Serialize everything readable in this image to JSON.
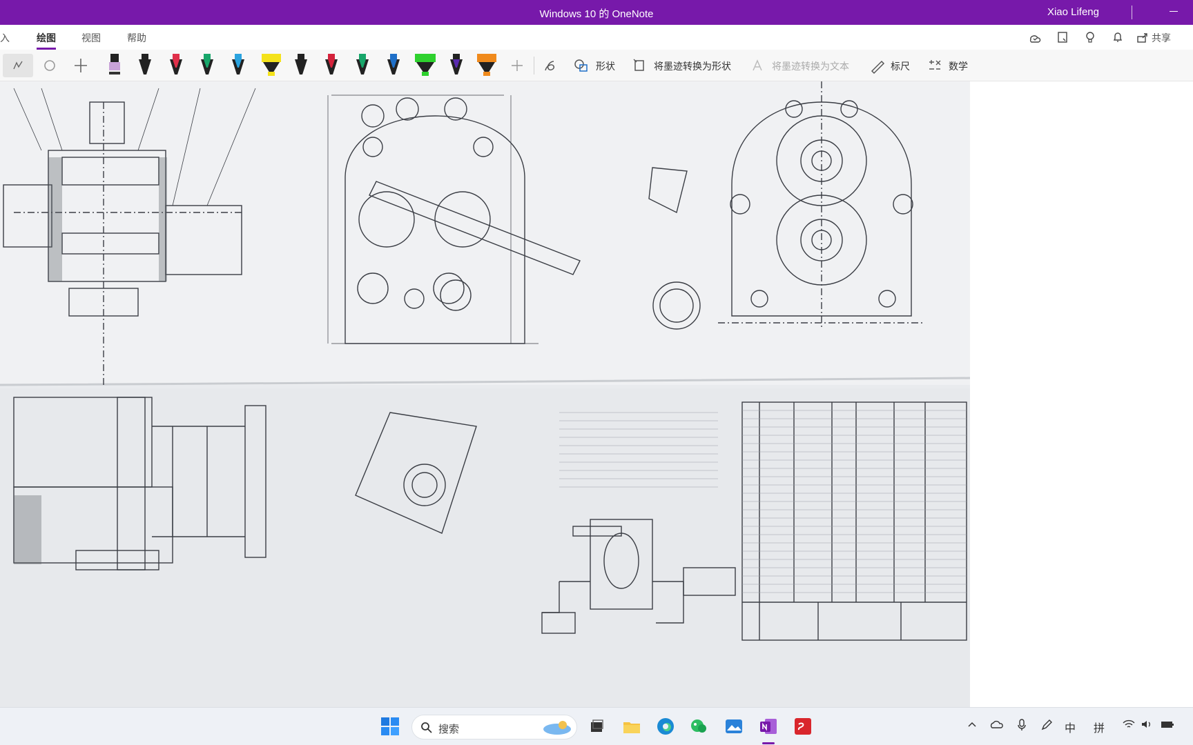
{
  "window": {
    "title": "Windows 10 的 OneNote",
    "user": "Xiao Lifeng"
  },
  "ribbon": {
    "tabs": [
      {
        "label": "插入"
      },
      {
        "label": "绘图"
      },
      {
        "label": "视图"
      },
      {
        "label": "帮助"
      }
    ],
    "active_tab": "绘图",
    "share_label": "共享"
  },
  "draw_toolbar": {
    "pens": [
      {
        "color": "#333333",
        "tip": "#c9a3d8"
      },
      {
        "color": "#222222",
        "tip": "#222222"
      },
      {
        "color": "#e0304a",
        "tip": "#e0304a"
      },
      {
        "color": "#17a66a",
        "tip": "#17a66a"
      },
      {
        "color": "#2aa3df",
        "tip": "#2aa3df"
      },
      {
        "color": "#f4e21b",
        "tip": "#f4e21b"
      },
      {
        "color": "#222222",
        "tip": "#222222"
      },
      {
        "color": "#d4223b",
        "tip": "#d4223b"
      },
      {
        "color": "#17a66a",
        "tip": "#17a66a"
      },
      {
        "color": "#1e6fc8",
        "tip": "#1e6fc8"
      },
      {
        "color": "#2ed12e",
        "tip": "#2ed12e"
      },
      {
        "color": "#5a2bb0",
        "tip": "#5a2bb0"
      },
      {
        "color": "#f08a1c",
        "tip": "#f08a1c"
      }
    ],
    "shapes_label": "形状",
    "ink_to_shape_label": "将墨迹转换为形状",
    "ink_to_text_label": "将墨迹转换为文本",
    "ruler_label": "标尺",
    "math_label": "数学"
  },
  "taskbar": {
    "search_placeholder": "搜索",
    "tray_ime": "中",
    "tray_pinyin": "拼"
  },
  "colors": {
    "accent": "#7719aa"
  }
}
